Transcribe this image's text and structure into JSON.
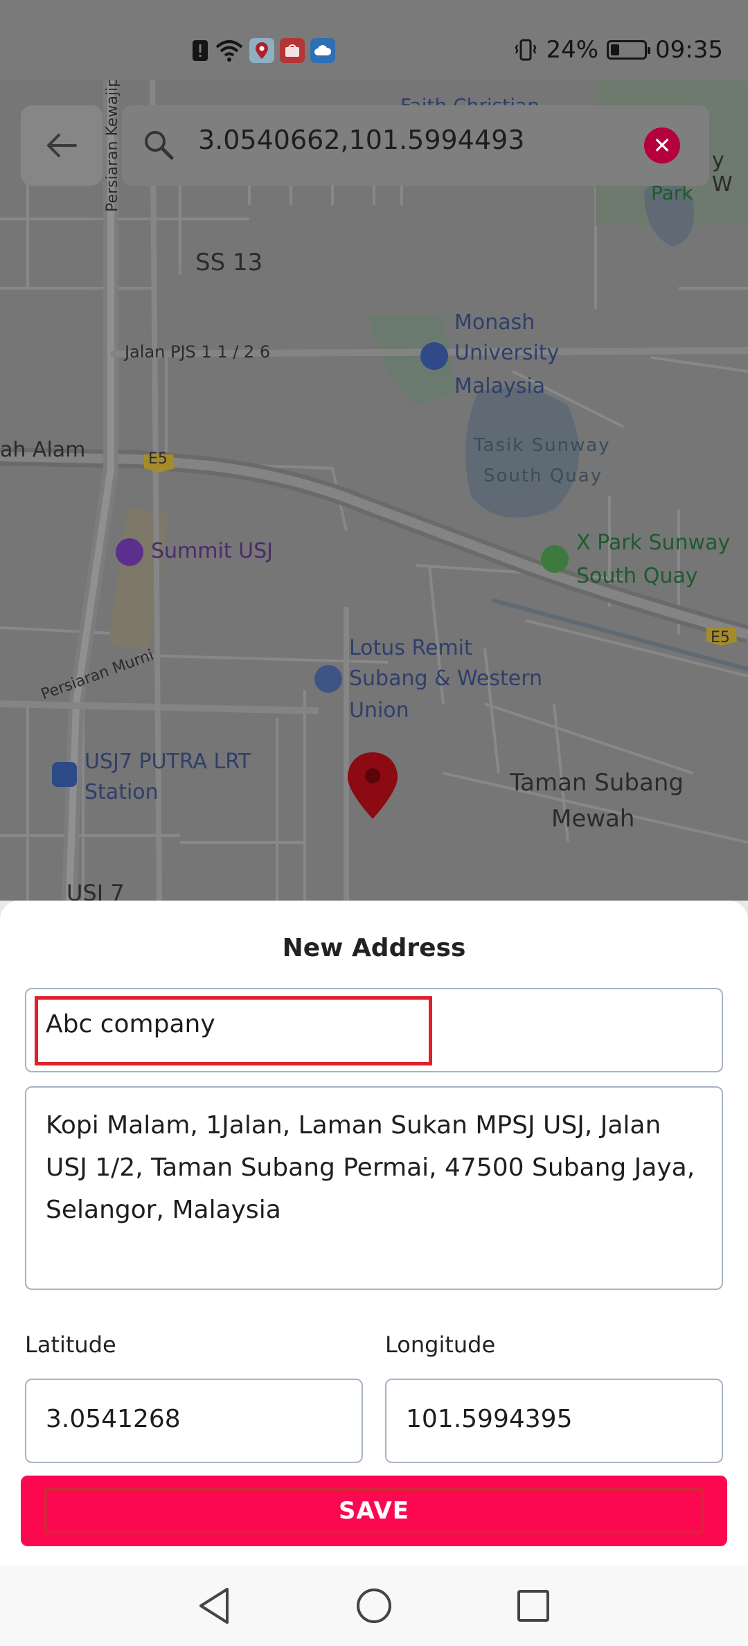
{
  "status_bar": {
    "battery_percent": "24%",
    "battery_level": 0.24,
    "time": "09:35",
    "icons": [
      "alert-icon",
      "wifi-icon",
      "maps-app-icon",
      "shop-app-icon",
      "cloud-app-icon",
      "vibrate-icon",
      "battery-icon"
    ]
  },
  "search": {
    "query": "3.0540662,101.5994493"
  },
  "map": {
    "labels": {
      "ss13": "SS 13",
      "jalan_pjs": "Jalan PJS 1 1 / 2 6",
      "persiaran_kewajipan": "Persiaran Kewajip",
      "monash_1": "Monash",
      "monash_2": "University",
      "monash_3": "Malaysia",
      "tasik_1": "Tasik Sunway",
      "tasik_2": "South Quay",
      "alam": "ah Alam",
      "e5_a": "E5",
      "e5_b": "E5",
      "summit": "Summit USJ",
      "xpark_1": "X Park Sunway",
      "xpark_2": "South Quay",
      "lotus_1": "Lotus Remit",
      "lotus_2": "Subang & Western",
      "lotus_3": "Union",
      "persiaran_murni": "Persiaran Murni",
      "usj7_lrt_1": "USJ7 PUTRA LRT",
      "usj7_lrt_2": "Station",
      "taman_1": "Taman Subang",
      "taman_2": "Mewah",
      "usj7": "USJ 7",
      "faith": "Faith Christian",
      "park": "Park",
      "edge_w": "y W"
    }
  },
  "sheet": {
    "title": "New Address",
    "name_value": "Abc company",
    "address_value": "Kopi Malam, 1Jalan, Laman Sukan MPSJ USJ, Jalan USJ 1/2, Taman Subang Permai, 47500 Subang Jaya, Selangor, Malaysia",
    "latitude_label": "Latitude",
    "latitude_value": "3.0541268",
    "longitude_label": "Longitude",
    "longitude_value": "101.5994395",
    "save_label": "SAVE"
  },
  "colors": {
    "accent": "#fb0850",
    "highlight": "#e0202c"
  }
}
